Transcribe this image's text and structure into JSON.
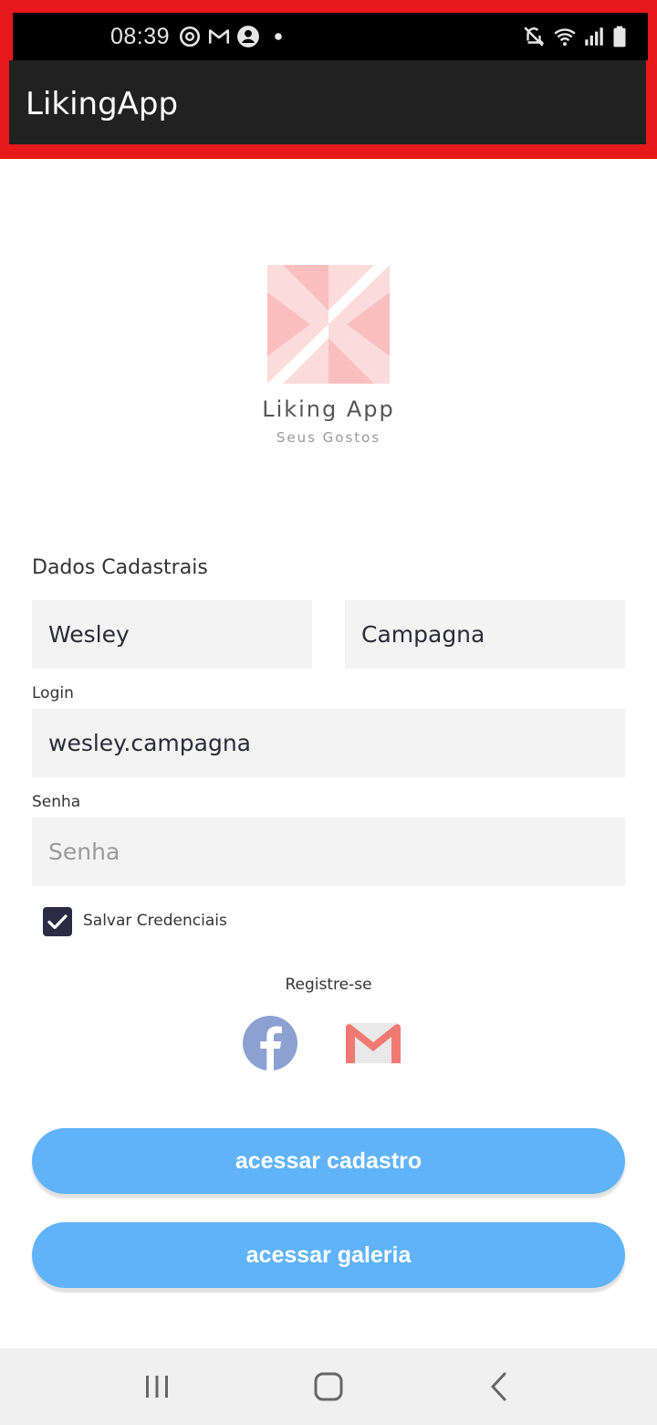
{
  "status_bar": {
    "time": "08:39",
    "left_icons": [
      "sync-icon",
      "gmail-icon",
      "account-icon",
      "dot-icon"
    ],
    "right_icons": [
      "mute-icon",
      "wifi-icon",
      "signal-icon",
      "battery-icon"
    ]
  },
  "app_bar": {
    "title": "LikingApp"
  },
  "logo": {
    "title": "Liking App",
    "subtitle": "Seus Gostos"
  },
  "form": {
    "section_label": "Dados Cadastrais",
    "first_name": "Wesley",
    "last_name": "Campagna",
    "login_label": "Login",
    "login_value": "wesley.campagna",
    "password_label": "Senha",
    "password_placeholder": "Senha",
    "save_credentials_label": "Salvar Credenciais",
    "save_credentials_checked": true
  },
  "register": {
    "label": "Registre-se",
    "providers": [
      "facebook-icon",
      "gmail-icon"
    ]
  },
  "buttons": {
    "cadastro": "acessar cadastro",
    "galeria": "acessar galeria"
  },
  "colors": {
    "accent_button": "#60b3f8",
    "app_bar": "#212121",
    "highlight_frame": "#e8191c",
    "checkbox": "#2b2b45"
  },
  "nav_bar": {
    "buttons": [
      "recents-icon",
      "home-icon",
      "back-icon"
    ]
  }
}
